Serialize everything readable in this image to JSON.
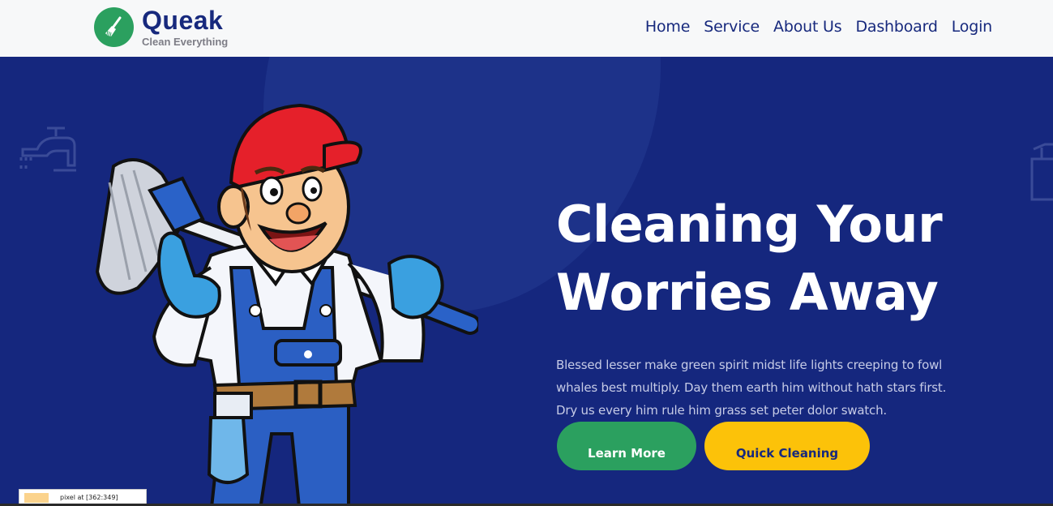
{
  "brand": {
    "name": "Queak",
    "tagline": "Clean Everything",
    "logo_icon": "broom-icon",
    "logo_color": "#2ba05f"
  },
  "nav": {
    "items": [
      {
        "label": "Home"
      },
      {
        "label": "Service"
      },
      {
        "label": "About Us"
      },
      {
        "label": "Dashboard"
      },
      {
        "label": "Login"
      }
    ]
  },
  "hero": {
    "title": "Cleaning Your Worries Away",
    "description": "Blessed lesser make green spirit midst life lights creeping to fowl whales best multiply. Day them earth him without hath stars first. Dry us every him rule him grass set peter dolor swatch.",
    "background_color": "#15277e",
    "buttons": {
      "learn_more": "Learn More",
      "quick_cleaning": "Quick Cleaning"
    },
    "illustration": "cleaner-mascot-with-mop"
  },
  "colors": {
    "primary_navy": "#17297d",
    "accent_green": "#2ba05f",
    "accent_yellow": "#fcc209"
  },
  "overlay": {
    "pixel_readout": "pixel at [362:349]"
  }
}
